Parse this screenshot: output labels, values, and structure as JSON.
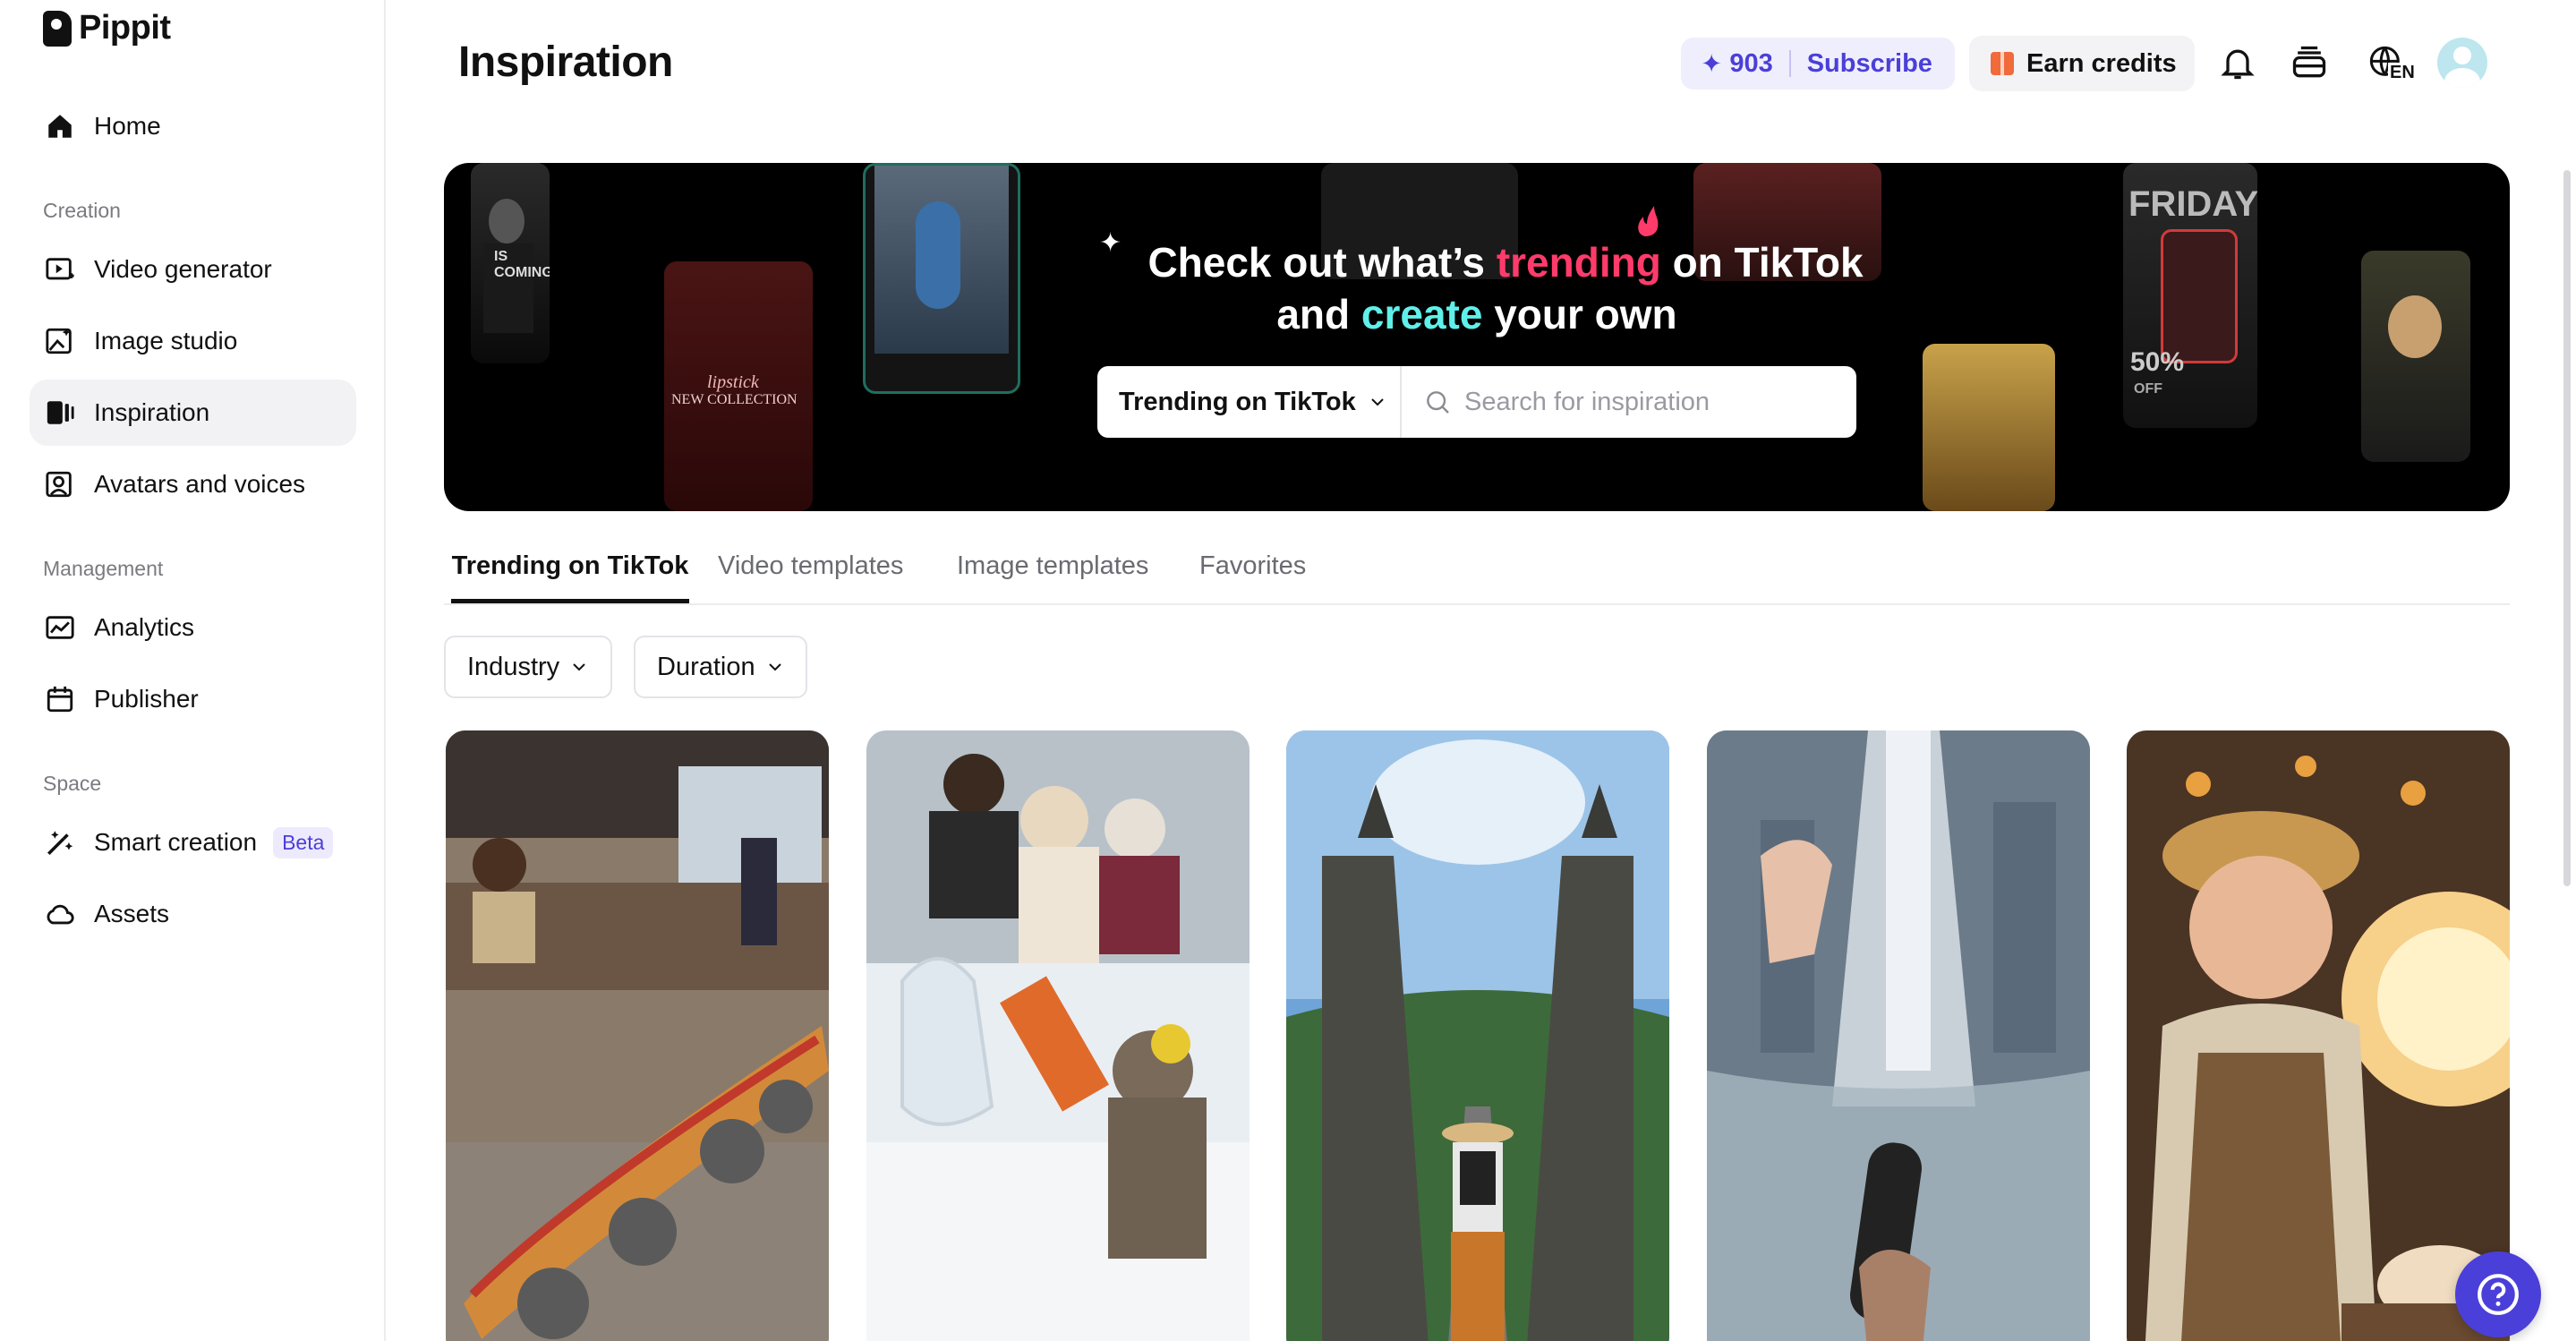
{
  "app": {
    "name": "Pippit"
  },
  "sidebar": {
    "items": [
      {
        "label": "Home",
        "icon": "home-icon"
      },
      {
        "label": "Video generator",
        "icon": "video-generator-icon"
      },
      {
        "label": "Image studio",
        "icon": "image-studio-icon"
      },
      {
        "label": "Inspiration",
        "icon": "inspiration-icon",
        "active": true
      },
      {
        "label": "Avatars and voices",
        "icon": "avatar-icon"
      },
      {
        "label": "Analytics",
        "icon": "analytics-icon"
      },
      {
        "label": "Publisher",
        "icon": "calendar-icon"
      },
      {
        "label": "Smart creation",
        "icon": "magic-wand-icon",
        "badge": "Beta"
      },
      {
        "label": "Assets",
        "icon": "cloud-icon"
      }
    ],
    "sections": {
      "creation": "Creation",
      "management": "Management",
      "space": "Space"
    }
  },
  "header": {
    "title": "Inspiration",
    "credits": "903",
    "subscribe_label": "Subscribe",
    "earn_label": "Earn credits",
    "language": "EN",
    "accent_color": "#4b3fd9"
  },
  "banner": {
    "text_a": "Check out what’s",
    "text_trending": "trending",
    "text_b": "on TikTok",
    "text_c": "and",
    "text_create": "create",
    "text_d": "your own",
    "search_select": "Trending on TikTok",
    "search_placeholder": "Search for inspiration",
    "thumb_texts": [
      "IS COMING",
      "lipstick",
      "NEW COLLECTION",
      "FRIDAY",
      "50%",
      "OFF"
    ]
  },
  "tabs": [
    {
      "label": "Trending on TikTok",
      "active": true
    },
    {
      "label": "Video templates"
    },
    {
      "label": "Image templates"
    },
    {
      "label": "Favorites"
    }
  ],
  "filters": {
    "industry": "Industry",
    "duration": "Duration"
  }
}
